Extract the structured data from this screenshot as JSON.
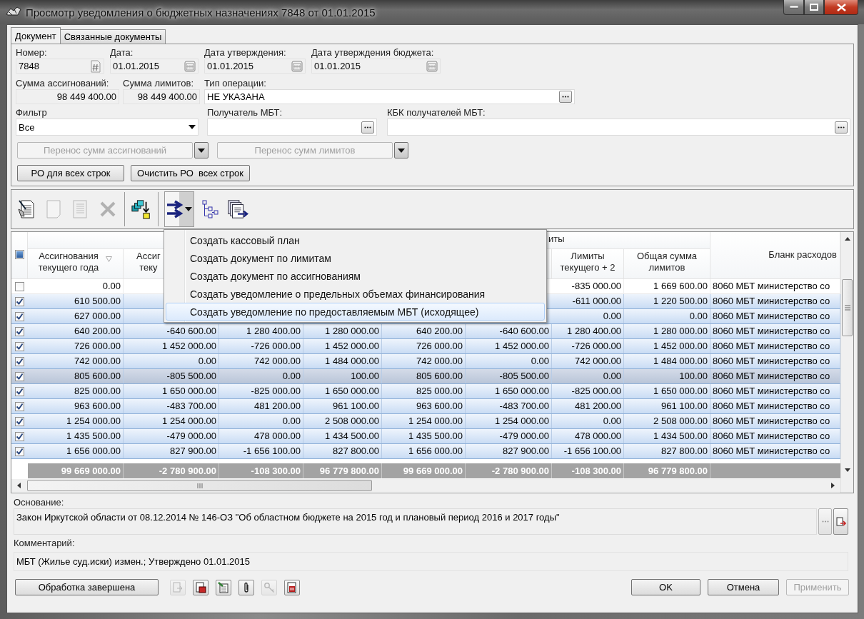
{
  "window": {
    "title": "Просмотр уведомления о бюджетных назначениях 7848 от 01.01.2015"
  },
  "tabs": [
    {
      "label": "Документ",
      "selected": true
    },
    {
      "label": "Связанные документы",
      "selected": false
    }
  ],
  "form": {
    "number": {
      "label": "Номер:",
      "value": "7848"
    },
    "date": {
      "label": "Дата:",
      "value": "01.01.2015"
    },
    "approval_date": {
      "label": "Дата утверждения:",
      "value": "01.01.2015"
    },
    "budget_approval_date": {
      "label": "Дата утверждения бюджета:",
      "value": "01.01.2015"
    },
    "appropriations_sum": {
      "label": "Сумма ассигнований:",
      "value": "98 449 400.00"
    },
    "limits_sum": {
      "label": "Сумма лимитов:",
      "value": "98 449 400.00"
    },
    "operation_type": {
      "label": "Тип операции:",
      "value": "НЕ УКАЗАНА"
    },
    "filter": {
      "label": "Фильтр",
      "value": "Все"
    },
    "recipient": {
      "label": "Получатель МБТ:"
    },
    "recipient_kbk": {
      "label": "КБК получателей МБТ:"
    },
    "transfer_buttons": [
      {
        "label": "Перенос сумм ассигнований",
        "disabled": true
      },
      {
        "label": "Перенос сумм лимитов",
        "disabled": true
      }
    ],
    "buttons": [
      {
        "label": "РО для всех строк"
      },
      {
        "label": "Очистить РО  всех строк"
      }
    ]
  },
  "toolbar": [
    {
      "kind": "edit",
      "disabled": false,
      "pressed": false
    },
    {
      "kind": "new",
      "disabled": true,
      "pressed": false
    },
    {
      "kind": "copy",
      "disabled": true,
      "pressed": false
    },
    {
      "kind": "delete",
      "disabled": true,
      "pressed": false
    },
    {
      "kind": "move",
      "disabled": false,
      "pressed": false
    },
    {
      "kind": "create",
      "disabled": false,
      "pressed": true
    },
    {
      "kind": "tree",
      "disabled": false,
      "pressed": false
    },
    {
      "kind": "export",
      "disabled": false,
      "pressed": false
    }
  ],
  "create_menu": {
    "items": [
      {
        "label": "Создать кассовый план",
        "selected": false
      },
      {
        "label": "Создать документ по лимитам",
        "selected": false
      },
      {
        "label": "Создать документ по ассигнованиям",
        "selected": false
      },
      {
        "label": "Создать уведомление о предельных объемах финансирования",
        "selected": false
      },
      {
        "label": "Создать уведомление по предоставляемым МБТ (исходящее)",
        "selected": true
      }
    ]
  },
  "table": {
    "select_all_partial": true,
    "group_header": {
      "label": "иты"
    },
    "columns": [
      "Ассигнования\nтекущего года",
      "Ассиг\nтеку",
      null,
      null,
      null,
      null,
      "Лимиты\nтекущего + 2",
      "Общая сумма\nлимитов",
      "Бланк расходов"
    ],
    "rows": [
      {
        "checked": false,
        "selected": false,
        "cells": [
          "0.00",
          null,
          null,
          null,
          null,
          null,
          "-835 000.00",
          "1 669 600.00",
          "8060 МБТ министерство со"
        ]
      },
      {
        "checked": true,
        "selected": false,
        "cells": [
          "610 500.00",
          null,
          null,
          null,
          null,
          null,
          "-611 000.00",
          "1 220 500.00",
          "8060 МБТ министерство со"
        ]
      },
      {
        "checked": true,
        "selected": false,
        "cells": [
          "627 000.00",
          null,
          null,
          null,
          null,
          null,
          "0.00",
          "0.00",
          "8060 МБТ министерство со"
        ]
      },
      {
        "checked": true,
        "selected": false,
        "cells": [
          "640 200.00",
          "-640 600.00",
          "1 280 400.00",
          "1 280 000.00",
          "640 200.00",
          "-640 600.00",
          "1 280 400.00",
          "1 280 000.00",
          "8060 МБТ министерство со"
        ]
      },
      {
        "checked": true,
        "selected": false,
        "cells": [
          "726 000.00",
          "1 452 000.00",
          "-726 000.00",
          "1 452 000.00",
          "726 000.00",
          "1 452 000.00",
          "-726 000.00",
          "1 452 000.00",
          "8060 МБТ министерство со"
        ]
      },
      {
        "checked": true,
        "selected": false,
        "cells": [
          "742 000.00",
          "0.00",
          "742 000.00",
          "1 484 000.00",
          "742 000.00",
          "0.00",
          "742 000.00",
          "1 484 000.00",
          "8060 МБТ министерство со"
        ]
      },
      {
        "checked": true,
        "selected": true,
        "cells": [
          "805 600.00",
          "-805 500.00",
          "0.00",
          "100.00",
          "805 600.00",
          "-805 500.00",
          "0.00",
          "100.00",
          "8060 МБТ министерство со"
        ]
      },
      {
        "checked": true,
        "selected": false,
        "cells": [
          "825 000.00",
          "1 650 000.00",
          "-825 000.00",
          "1 650 000.00",
          "825 000.00",
          "1 650 000.00",
          "-825 000.00",
          "1 650 000.00",
          "8060 МБТ министерство со"
        ]
      },
      {
        "checked": true,
        "selected": false,
        "cells": [
          "963 600.00",
          "-483 700.00",
          "481 200.00",
          "961 100.00",
          "963 600.00",
          "-483 700.00",
          "481 200.00",
          "961 100.00",
          "8060 МБТ министерство со"
        ]
      },
      {
        "checked": true,
        "selected": false,
        "cells": [
          "1 254 000.00",
          "1 254 000.00",
          "0.00",
          "2 508 000.00",
          "1 254 000.00",
          "1 254 000.00",
          "0.00",
          "2 508 000.00",
          "8060 МБТ министерство со"
        ]
      },
      {
        "checked": true,
        "selected": false,
        "cells": [
          "1 435 500.00",
          "-479 000.00",
          "478 000.00",
          "1 434 500.00",
          "1 435 500.00",
          "-479 000.00",
          "478 000.00",
          "1 434 500.00",
          "8060 МБТ министерство со"
        ]
      },
      {
        "checked": true,
        "selected": false,
        "cells": [
          "1 656 000.00",
          "827 900.00",
          "-1 656 100.00",
          "827 800.00",
          "1 656 000.00",
          "827 900.00",
          "-1 656 100.00",
          "827 800.00",
          "8060 МБТ министерство со"
        ]
      }
    ],
    "totals": [
      "99 669 000.00",
      "-2 780 900.00",
      "-108 300.00",
      "96 779 800.00",
      "99 669 000.00",
      "-2 780 900.00",
      "-108 300.00",
      "96 779 800.00"
    ]
  },
  "basis": {
    "label": "Основание:",
    "value": "Закон Иркутской области от 08.12.2014 № 146-ОЗ \"Об областном бюджете на 2015 год и плановый период 2016 и  2017  годы\""
  },
  "comment": {
    "label": "Комментарий:",
    "value": "МБТ (Жилье суд.иски) измен.; Утверждено 01.01.2015"
  },
  "footer": {
    "status_button": "Обработка завершена",
    "icon_buttons": [
      {
        "kind": "forward",
        "disabled": true
      },
      {
        "kind": "pdf",
        "disabled": false
      },
      {
        "kind": "excel",
        "disabled": false
      },
      {
        "kind": "attach",
        "disabled": false
      },
      {
        "kind": "key",
        "disabled": true
      },
      {
        "kind": "report",
        "disabled": false
      }
    ],
    "buttons": [
      {
        "label": "OK",
        "disabled": false
      },
      {
        "label": "Отмена",
        "disabled": false
      },
      {
        "label": "Применить",
        "disabled": true
      }
    ]
  }
}
